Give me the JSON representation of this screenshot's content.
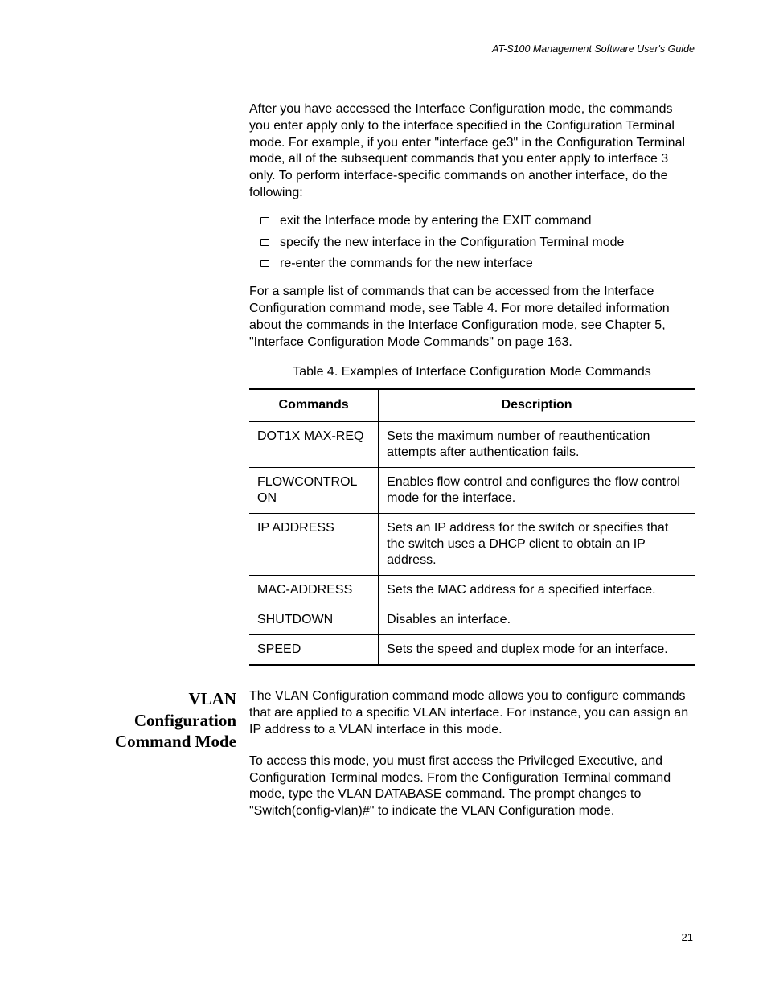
{
  "header": "AT-S100 Management Software User's Guide",
  "intro_para": "After you have accessed the Interface Configuration mode, the commands you enter apply only to the interface specified in the Configuration Terminal mode. For example, if you enter \"interface ge3\" in the Configuration Terminal mode, all of the subsequent commands that you enter apply to interface 3 only. To perform interface-specific commands on another interface, do the following:",
  "bullets": [
    "exit the Interface mode by entering the EXIT command",
    "specify the new interface in the Configuration Terminal mode",
    "re-enter the commands for the new interface"
  ],
  "sample_para": "For a sample list of commands that can be accessed from the Interface Configuration command mode, see Table 4. For more detailed information about the commands in the Interface Configuration mode, see Chapter 5, \"Interface Configuration Mode Commands\" on page 163.",
  "table_caption": "Table 4. Examples of Interface Configuration Mode Commands",
  "table_headers": {
    "col1": "Commands",
    "col2": "Description"
  },
  "table_rows": [
    {
      "cmd": "DOT1X MAX-REQ",
      "desc": "Sets the maximum number of reauthentication attempts after authentication fails."
    },
    {
      "cmd": "FLOWCONTROL ON",
      "desc": "Enables flow control and configures the flow control mode for the interface."
    },
    {
      "cmd": "IP ADDRESS",
      "desc": "Sets an IP address for the switch or specifies that the switch uses a DHCP client to obtain an IP address."
    },
    {
      "cmd": "MAC-ADDRESS",
      "desc": "Sets the MAC address for a specified interface."
    },
    {
      "cmd": "SHUTDOWN",
      "desc": "Disables an interface."
    },
    {
      "cmd": "SPEED",
      "desc": "Sets the speed and duplex mode for an interface."
    }
  ],
  "section_heading": "VLAN Configuration Command Mode",
  "section_para1": "The VLAN Configuration command mode allows you to configure commands that are applied to a specific VLAN interface. For instance, you can assign an IP address to a VLAN interface in this mode.",
  "section_para2": "To access this mode, you must first access the Privileged Executive, and Configuration Terminal modes. From the Configuration Terminal command mode, type the VLAN DATABASE command. The prompt changes to \"Switch(config-vlan)#\" to indicate the VLAN Configuration mode.",
  "page_number": "21"
}
